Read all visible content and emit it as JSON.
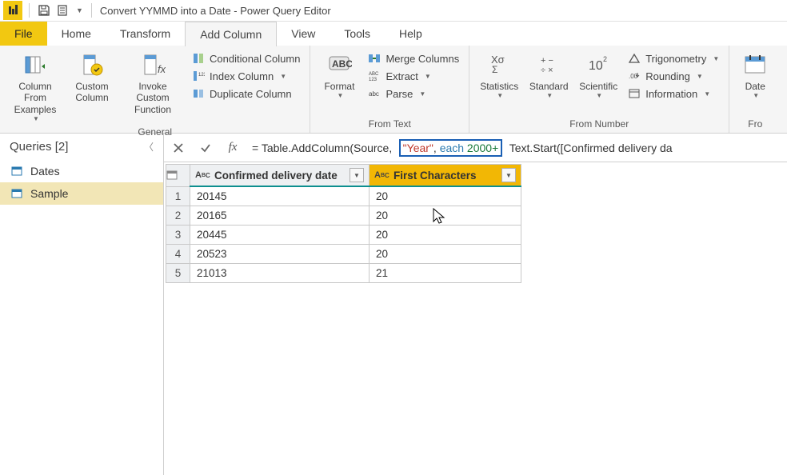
{
  "window": {
    "title": "Convert YYMMD into a Date - Power Query Editor"
  },
  "tabs": {
    "file": "File",
    "home": "Home",
    "transform": "Transform",
    "add_column": "Add Column",
    "view": "View",
    "tools": "Tools",
    "help": "Help"
  },
  "ribbon": {
    "general": {
      "label": "General",
      "column_from_examples": "Column From Examples",
      "custom_column": "Custom Column",
      "invoke_custom_function": "Invoke Custom Function",
      "conditional_column": "Conditional Column",
      "index_column": "Index Column",
      "duplicate_column": "Duplicate Column"
    },
    "from_text": {
      "label": "From Text",
      "format": "Format",
      "merge_columns": "Merge Columns",
      "extract": "Extract",
      "parse": "Parse"
    },
    "from_number": {
      "label": "From Number",
      "statistics": "Statistics",
      "standard": "Standard",
      "scientific": "Scientific",
      "trigonometry": "Trigonometry",
      "rounding": "Rounding",
      "information": "Information"
    },
    "date_partial": "Date"
  },
  "queries": {
    "header": "Queries [2]",
    "items": [
      "Dates",
      "Sample"
    ]
  },
  "formula": {
    "prefix": "= Table.AddColumn(Source,",
    "hl_str": "\"Year\"",
    "hl_comma": ", ",
    "hl_kw": "each",
    "hl_num": " 2000+",
    "suffix": "Text.Start([Confirmed delivery da"
  },
  "grid": {
    "columns": [
      "Confirmed delivery date",
      "First Characters"
    ],
    "rows": [
      {
        "n": "1",
        "c1": "20145",
        "c2": "20"
      },
      {
        "n": "2",
        "c1": "20165",
        "c2": "20"
      },
      {
        "n": "3",
        "c1": "20445",
        "c2": "20"
      },
      {
        "n": "4",
        "c1": "20523",
        "c2": "20"
      },
      {
        "n": "5",
        "c1": "21013",
        "c2": "21"
      }
    ]
  },
  "from_label": "Fro"
}
